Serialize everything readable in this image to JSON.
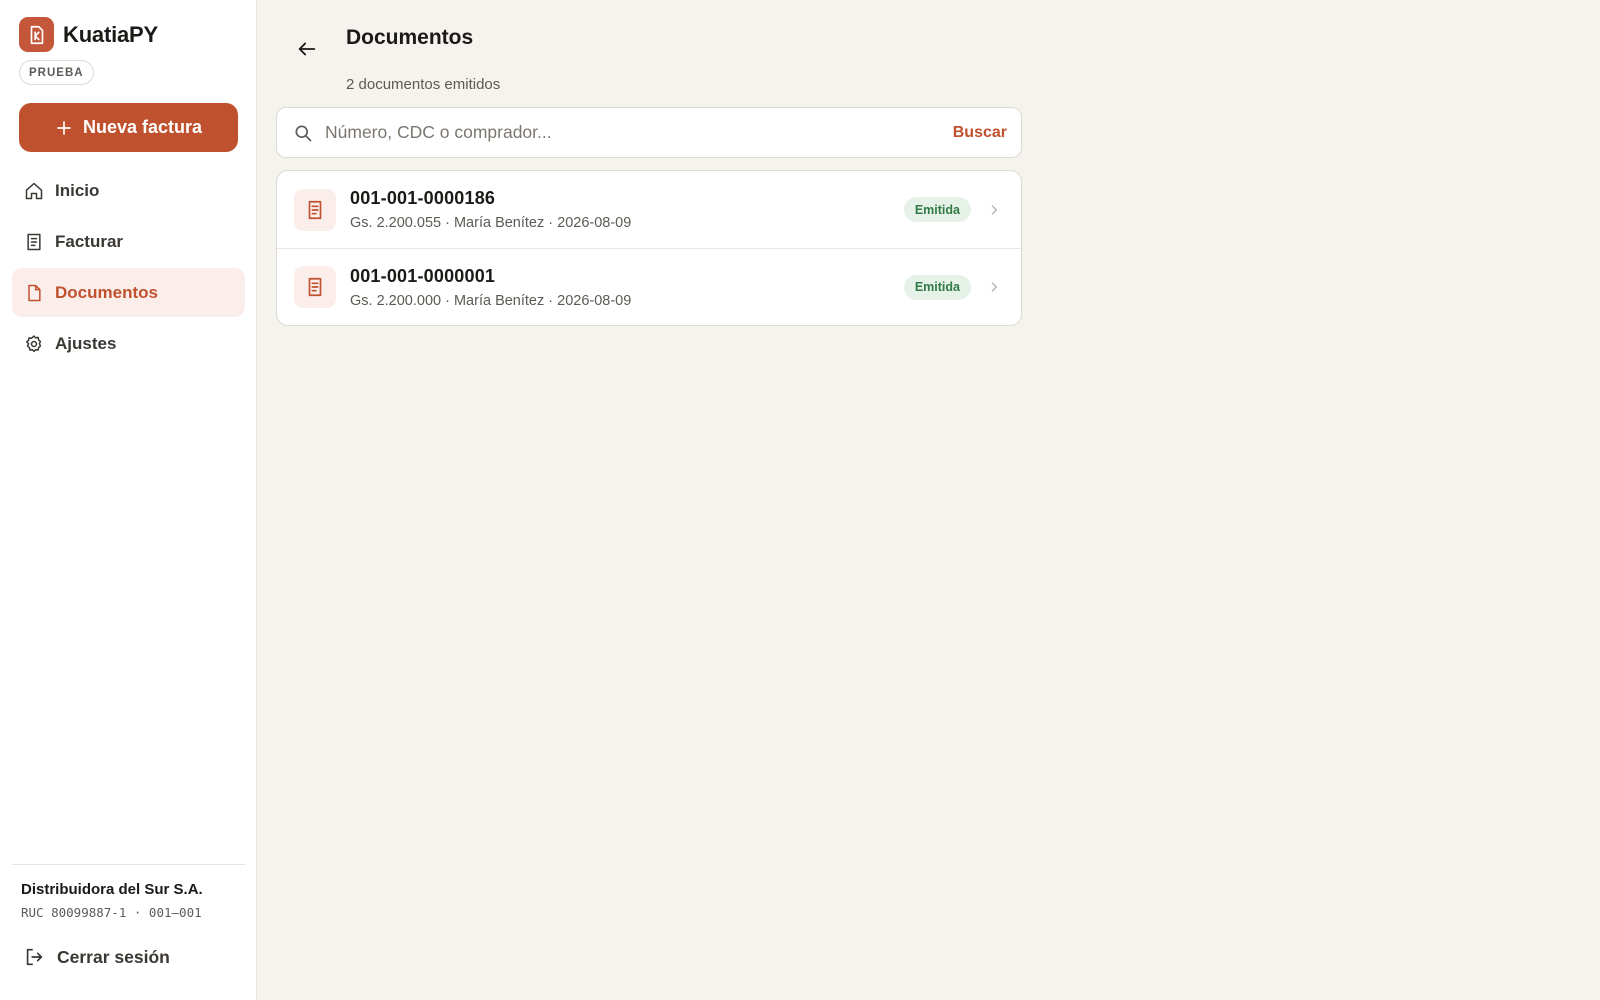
{
  "app": {
    "name": "KuatiaPY",
    "environment_badge": "PRUEBA"
  },
  "sidebar": {
    "new_invoice_label": "Nueva factura",
    "items": [
      {
        "label": "Inicio",
        "icon": "home-icon",
        "active": false
      },
      {
        "label": "Facturar",
        "icon": "receipt-icon",
        "active": false
      },
      {
        "label": "Documentos",
        "icon": "file-icon",
        "active": true
      },
      {
        "label": "Ajustes",
        "icon": "gear-icon",
        "active": false
      }
    ],
    "company": {
      "name": "Distribuidora del Sur S.A.",
      "ruc_line": "RUC 80099887-1 · 001–001"
    },
    "logout_label": "Cerrar sesión"
  },
  "header": {
    "title": "Documentos",
    "subtitle": "2 documentos emitidos"
  },
  "search": {
    "placeholder": "Número, CDC o comprador...",
    "value": "",
    "button_label": "Buscar"
  },
  "documents": [
    {
      "number": "001-001-0000186",
      "meta": "Gs. 2.200.055 · María Benítez · 2026-08-09",
      "status": "Emitida"
    },
    {
      "number": "001-001-0000001",
      "meta": "Gs. 2.200.000 · María Benítez · 2026-08-09",
      "status": "Emitida"
    }
  ],
  "colors": {
    "accent": "#c0512f",
    "background": "#f4f3ee",
    "status_green": "#2f7a45",
    "status_green_bg": "#e6f1e8"
  }
}
